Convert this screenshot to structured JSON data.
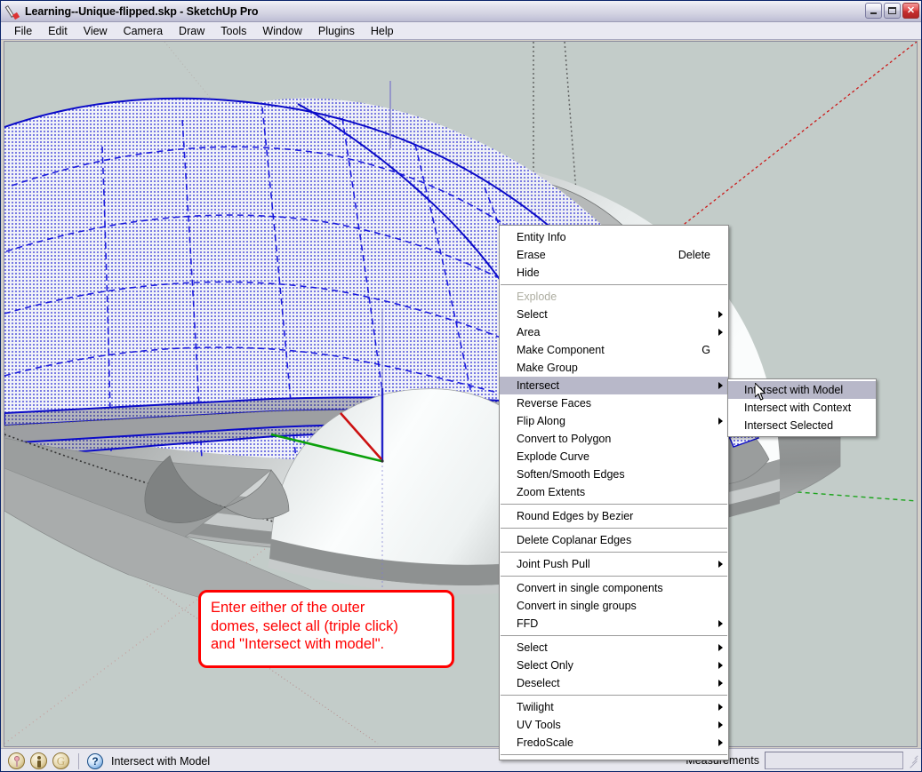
{
  "window": {
    "title": "Learning--Unique-flipped.skp - SketchUp Pro",
    "app_icon": "pencil-icon",
    "minimize_label": "Minimize",
    "maximize_label": "Maximize",
    "close_label": "Close"
  },
  "menubar": {
    "items": [
      {
        "label": "File"
      },
      {
        "label": "Edit"
      },
      {
        "label": "View"
      },
      {
        "label": "Camera"
      },
      {
        "label": "Draw"
      },
      {
        "label": "Tools"
      },
      {
        "label": "Window"
      },
      {
        "label": "Plugins"
      },
      {
        "label": "Help"
      }
    ]
  },
  "viewport": {
    "background_color": "#c3ccc9",
    "selection_color": "#0000ee",
    "axis_red": "#cc0000",
    "axis_green": "#00a000",
    "axis_blue": "#2020cc",
    "description": "3D model of nested hemispherical domes with an arched opening; outer dome is selected showing blue dotted face selection and dashed blue edges"
  },
  "callout": {
    "border_color": "#ff0000",
    "text_color": "#ff0000",
    "lines": [
      "Enter either of the outer",
      "domes, select all (triple click)",
      "and \"Intersect with model\"."
    ]
  },
  "context_menu": {
    "highlight_color": "#b8b8c9",
    "groups": [
      {
        "items": [
          {
            "label": "Entity Info",
            "accel": "",
            "arrow": false,
            "disabled": false,
            "selected": false
          },
          {
            "label": "Erase",
            "accel": "Delete",
            "arrow": false,
            "disabled": false,
            "selected": false
          },
          {
            "label": "Hide",
            "accel": "",
            "arrow": false,
            "disabled": false,
            "selected": false
          }
        ]
      },
      {
        "items": [
          {
            "label": "Explode",
            "accel": "",
            "arrow": false,
            "disabled": true,
            "selected": false
          },
          {
            "label": "Select",
            "accel": "",
            "arrow": true,
            "disabled": false,
            "selected": false
          },
          {
            "label": "Area",
            "accel": "",
            "arrow": true,
            "disabled": false,
            "selected": false
          },
          {
            "label": "Make Component",
            "accel": "G",
            "arrow": false,
            "disabled": false,
            "selected": false
          },
          {
            "label": "Make Group",
            "accel": "",
            "arrow": false,
            "disabled": false,
            "selected": false
          },
          {
            "label": "Intersect",
            "accel": "",
            "arrow": true,
            "disabled": false,
            "selected": true
          },
          {
            "label": "Reverse Faces",
            "accel": "",
            "arrow": false,
            "disabled": false,
            "selected": false
          },
          {
            "label": "Flip Along",
            "accel": "",
            "arrow": true,
            "disabled": false,
            "selected": false
          },
          {
            "label": "Convert to Polygon",
            "accel": "",
            "arrow": false,
            "disabled": false,
            "selected": false
          },
          {
            "label": "Explode Curve",
            "accel": "",
            "arrow": false,
            "disabled": false,
            "selected": false
          },
          {
            "label": "Soften/Smooth Edges",
            "accel": "",
            "arrow": false,
            "disabled": false,
            "selected": false
          },
          {
            "label": "Zoom Extents",
            "accel": "",
            "arrow": false,
            "disabled": false,
            "selected": false
          }
        ]
      },
      {
        "items": [
          {
            "label": "Round Edges by Bezier",
            "accel": "",
            "arrow": false,
            "disabled": false,
            "selected": false
          }
        ]
      },
      {
        "items": [
          {
            "label": "Delete Coplanar Edges",
            "accel": "",
            "arrow": false,
            "disabled": false,
            "selected": false
          }
        ]
      },
      {
        "items": [
          {
            "label": "Joint Push Pull",
            "accel": "",
            "arrow": true,
            "disabled": false,
            "selected": false
          }
        ]
      },
      {
        "items": [
          {
            "label": "Convert in single components",
            "accel": "",
            "arrow": false,
            "disabled": false,
            "selected": false
          },
          {
            "label": "Convert in single groups",
            "accel": "",
            "arrow": false,
            "disabled": false,
            "selected": false
          },
          {
            "label": "FFD",
            "accel": "",
            "arrow": true,
            "disabled": false,
            "selected": false
          }
        ]
      },
      {
        "items": [
          {
            "label": "Select",
            "accel": "",
            "arrow": true,
            "disabled": false,
            "selected": false
          },
          {
            "label": "Select Only",
            "accel": "",
            "arrow": true,
            "disabled": false,
            "selected": false
          },
          {
            "label": "Deselect",
            "accel": "",
            "arrow": true,
            "disabled": false,
            "selected": false
          }
        ]
      },
      {
        "items": [
          {
            "label": "Twilight",
            "accel": "",
            "arrow": true,
            "disabled": false,
            "selected": false
          },
          {
            "label": "UV Tools",
            "accel": "",
            "arrow": true,
            "disabled": false,
            "selected": false
          },
          {
            "label": "FredoScale",
            "accel": "",
            "arrow": true,
            "disabled": false,
            "selected": false
          }
        ]
      }
    ]
  },
  "submenu": {
    "items": [
      {
        "label": "Intersect with Model",
        "selected": true
      },
      {
        "label": "Intersect with Context",
        "selected": false
      },
      {
        "label": "Intersect Selected",
        "selected": false
      }
    ]
  },
  "statusbar": {
    "icons": [
      {
        "name": "geo-location-icon"
      },
      {
        "name": "geo-person-icon"
      },
      {
        "name": "geo-google-icon"
      }
    ],
    "help_icon": "question-mark-icon",
    "status_text": "Intersect with Model",
    "measurements_label": "Measurements",
    "measurements_value": "",
    "resize_grip": "resize-grip-icon"
  }
}
